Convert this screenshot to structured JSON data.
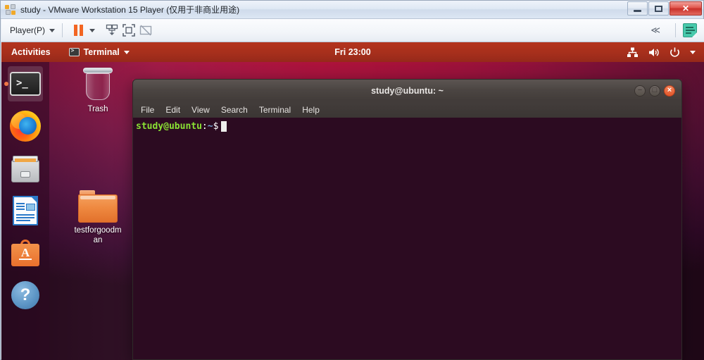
{
  "host_window": {
    "title": "study - VMware Workstation 15 Player (仅用于非商业用途)",
    "app_icon": "vmware-player-icon",
    "buttons": {
      "minimize": "minimize-button",
      "restore": "restore-button",
      "close": "✕"
    }
  },
  "vm_toolbar": {
    "player_menu": "Player(P)",
    "items": [
      {
        "name": "pause-button",
        "label": "Pause"
      },
      {
        "name": "pause-dropdown",
        "label": "Pause options"
      },
      {
        "name": "send-ctrl-alt-del-button",
        "label": "Send Ctrl+Alt+Del"
      },
      {
        "name": "enter-fullscreen-button",
        "label": "Enter Full Screen"
      },
      {
        "name": "unity-mode-button",
        "label": "Unity Mode"
      }
    ],
    "collapse_label": "≪",
    "notes_label": "Notes"
  },
  "guest": {
    "topbar": {
      "activities": "Activities",
      "app_menu": "Terminal",
      "app_icon": "terminal-icon",
      "clock": "Fri 23:00",
      "tray": [
        {
          "name": "network-icon",
          "label": "Network"
        },
        {
          "name": "volume-icon",
          "label": "Volume"
        },
        {
          "name": "power-icon",
          "label": "Power"
        },
        {
          "name": "system-menu-caret-icon",
          "label": "System menu"
        }
      ]
    },
    "dock": [
      {
        "name": "dock-item-terminal",
        "label": "Terminal",
        "icon": "terminal-icon",
        "active": true
      },
      {
        "name": "dock-item-firefox",
        "label": "Firefox Web Browser",
        "icon": "firefox-icon",
        "active": false
      },
      {
        "name": "dock-item-files",
        "label": "Files",
        "icon": "files-cabinet-icon",
        "active": false
      },
      {
        "name": "dock-item-libreoffice-writer",
        "label": "LibreOffice Writer",
        "icon": "document-icon",
        "active": false
      },
      {
        "name": "dock-item-ubuntu-software",
        "label": "Ubuntu Software",
        "icon": "software-bag-icon",
        "active": false
      },
      {
        "name": "dock-item-help",
        "label": "Help",
        "icon": "help-question-icon",
        "active": false
      }
    ],
    "desktop_icons": [
      {
        "name": "desktop-icon-trash",
        "label": "Trash",
        "icon": "trash-icon"
      },
      {
        "name": "desktop-icon-folder",
        "label": "testforgoodman",
        "icon": "folder-icon"
      }
    ]
  },
  "terminal": {
    "title": "study@ubuntu: ~",
    "menus": [
      "File",
      "Edit",
      "View",
      "Search",
      "Terminal",
      "Help"
    ],
    "window_buttons": {
      "minimize": "−",
      "maximize": "□",
      "close": "×"
    },
    "prompt": {
      "user_host": "study@ubuntu",
      "separator": ":",
      "path": "~",
      "sigil": "$",
      "command": ""
    }
  },
  "colors": {
    "ubuntu_accent": "#e95420",
    "terminal_bg": "#2c0b21",
    "prompt_green": "#8ae234",
    "prompt_blue": "#729fcf",
    "topbar_red": "#a62f1c"
  }
}
